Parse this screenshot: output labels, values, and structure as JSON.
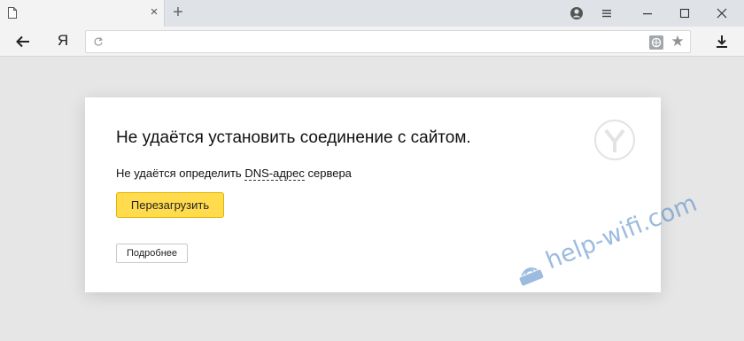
{
  "tab": {
    "title": " ",
    "close": "×",
    "new_tab": "+"
  },
  "nav": {
    "ya": "Я",
    "url": "  ",
    "star": "★"
  },
  "error": {
    "title": "Не удаётся установить соединение с сайтом.",
    "desc_prefix": "Не удаётся определить ",
    "dns_term": "DNS-адрес",
    "desc_suffix": " сервера",
    "host": "",
    "reload_label": "Перезагрузить",
    "details_label": "Подробнее"
  },
  "watermark": {
    "logo_text": "help-wifi.com"
  },
  "colors": {
    "reload_button": "#ffdb4d",
    "watermark": "#4883c4"
  },
  "icons": [
    "page-icon",
    "tab-close-icon",
    "new-tab-icon",
    "profile-icon",
    "menu-icon",
    "minimize-icon",
    "maximize-icon",
    "close-icon",
    "back-arrow-icon",
    "yandex-button",
    "reload-icon",
    "site-badge-icon",
    "star-icon",
    "download-icon",
    "yandex-browser-logo"
  ]
}
